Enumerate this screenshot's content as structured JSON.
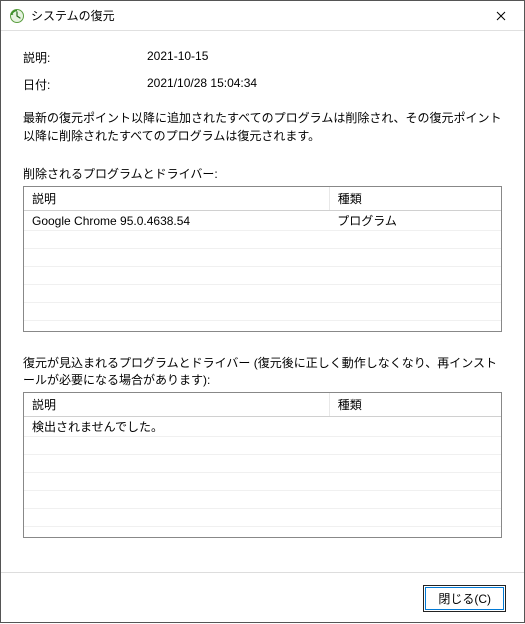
{
  "window": {
    "title": "システムの復元"
  },
  "fields": {
    "desc_label": "説明:",
    "desc_value": "2021-10-15",
    "date_label": "日付:",
    "date_value": "2021/10/28 15:04:34"
  },
  "info": "最新の復元ポイント以降に追加されたすべてのプログラムは削除され、その復元ポイント以降に削除されたすべてのプログラムは復元されます。",
  "section1": {
    "label": "削除されるプログラムとドライバー:",
    "col_desc": "説明",
    "col_type": "種類",
    "rows": [
      {
        "desc": "Google Chrome 95.0.4638.54",
        "type": "プログラム"
      }
    ]
  },
  "section2": {
    "label": "復元が見込まれるプログラムとドライバー (復元後に正しく動作しなくなり、再インストールが必要になる場合があります):",
    "col_desc": "説明",
    "col_type": "種類",
    "none_text": "検出されませんでした。"
  },
  "buttons": {
    "close": "閉じる(C)"
  }
}
